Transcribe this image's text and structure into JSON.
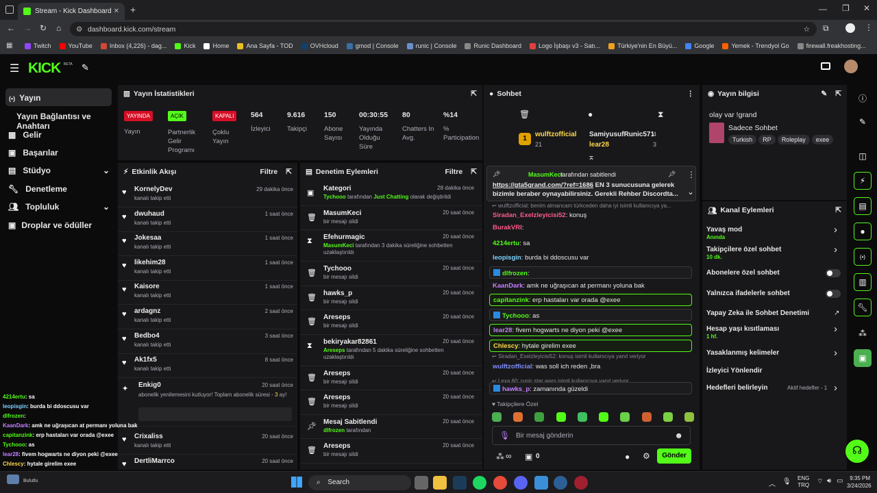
{
  "browser": {
    "tab_title": "Stream - Kick Dashboard",
    "url": "dashboard.kick.com/stream",
    "bookmarks": [
      "Twitch",
      "YouTube",
      "Inbox (4,226) - dag...",
      "Kick",
      "Home",
      "Ana Sayfa - TOD",
      "OVHcloud",
      "gmod | Console",
      "runic | Console",
      "Runic Dashboard",
      "Logo İşbaşı v3 - Satı...",
      "Türkiye'nin En Büyü...",
      "Google",
      "Yemek - Trendyol Go",
      "firewall.freakhosting..."
    ]
  },
  "logo": {
    "text": "KICK",
    "beta": "BETA"
  },
  "nav": {
    "items": [
      {
        "label": "Yayın",
        "icon": "broadcast-icon"
      },
      {
        "label": "Yayın Bağlantısı ve Anahtarı"
      },
      {
        "label": "Gelir",
        "icon": "money-icon"
      },
      {
        "label": "Başarılar",
        "icon": "trophy-icon"
      },
      {
        "label": "Stüdyo",
        "icon": "studio-icon"
      },
      {
        "label": "Denetleme",
        "icon": "wrench-icon"
      },
      {
        "label": "Topluluk",
        "icon": "people-icon"
      },
      {
        "label": "Droplar ve ödüller",
        "icon": "gift-icon"
      }
    ]
  },
  "stats": {
    "title": "Yayın İstatistikleri",
    "items": [
      {
        "badge": "YAYINDA",
        "label": "Yayın"
      },
      {
        "badge": "AÇIK",
        "label": "Partnerlik Gelir Programı"
      },
      {
        "badge": "KAPALI",
        "label": "Çoklu Yayın"
      },
      {
        "value": "564",
        "label": "İzleyici"
      },
      {
        "value": "9.616",
        "label": "Takipçi"
      },
      {
        "value": "150",
        "label": "Abone Sayısı"
      },
      {
        "value": "00:30:55",
        "label": "Yayında Olduğu Süre"
      },
      {
        "value": "80",
        "label": "Chatters In Avg."
      },
      {
        "value": "%14",
        "label": "% Participation"
      }
    ]
  },
  "activity": {
    "title": "Etkinlik Akışı",
    "filter": "Filtre",
    "items": [
      {
        "name": "KornelyDev",
        "sub": "kanalı takip etti",
        "time": "29 dakika önce"
      },
      {
        "name": "dwuhaud",
        "sub": "kanalı takip etti",
        "time": "1 saat önce"
      },
      {
        "name": "Jokesaa",
        "sub": "kanalı takip etti",
        "time": "1 saat önce"
      },
      {
        "name": "likehim28",
        "sub": "kanalı takip etti",
        "time": "1 saat önce"
      },
      {
        "name": "Kaisore",
        "sub": "kanalı takip etti",
        "time": "1 saat önce"
      },
      {
        "name": "ardagnz",
        "sub": "kanalı takip etti",
        "time": "2 saat önce"
      },
      {
        "name": "Bedbo4",
        "sub": "kanalı takip etti",
        "time": "3 saat önce"
      },
      {
        "name": "Ak1fx5",
        "sub": "kanalı takip etti",
        "time": "8 saat önce"
      }
    ],
    "sub_item": {
      "name": "Enkig0",
      "text_a": "abonelik yenilemesini kutluyor! Toplam abonelik süresi - ",
      "text_b": "3",
      "text_c": " ay!",
      "time": "20 saat önce"
    },
    "after": [
      {
        "name": "Crixaliss",
        "sub": "kanalı takip etti",
        "time": "20 saat önce"
      },
      {
        "name": "DertliMarrco",
        "sub": "",
        "time": "20 saat önce"
      }
    ]
  },
  "moderation": {
    "title": "Denetim Eylemleri",
    "filter": "Filtre",
    "items": [
      {
        "name": "Kategori",
        "actor": "Tychooo",
        "mid": " tarafından ",
        "target": "Just Chatting",
        "rest": " olarak değiştirildi",
        "time": "28 dakika önce",
        "icon": "category-icon"
      },
      {
        "name": "MasumKeci",
        "sub": "bir mesajı sildi",
        "time": "20 saat önce",
        "icon": "trash-icon"
      },
      {
        "name": "Efehurmagic",
        "actor": "MasumKeci",
        "rest": " tarafından 3 dakika süreliğine sohbetten uzaklaştırıldı",
        "time": "20 saat önce",
        "icon": "hourglass-icon"
      },
      {
        "name": "Tychooo",
        "sub": "bir mesajı sildi",
        "time": "20 saat önce",
        "icon": "trash-icon"
      },
      {
        "name": "hawks_p",
        "sub": "bir mesajı sildi",
        "time": "20 saat önce",
        "icon": "trash-icon"
      },
      {
        "name": "Areseps",
        "sub": "bir mesajı sildi",
        "time": "20 saat önce",
        "icon": "trash-icon"
      },
      {
        "name": "bekiryakar82861",
        "actor": "Areseps",
        "rest": " tarafından 5 dakika süreliğine sohbetten uzaklaştırıldı",
        "time": "20 saat önce",
        "icon": "hourglass-icon"
      },
      {
        "name": "Areseps",
        "sub": "bir mesajı sildi",
        "time": "20 saat önce",
        "icon": "trash-icon"
      },
      {
        "name": "Areseps",
        "sub": "bir mesajı sildi",
        "time": "20 saat önce",
        "icon": "trash-icon"
      },
      {
        "name": "Mesaj Sabitlendi",
        "actor": "dlfrozen",
        "rest": " tarafından",
        "time": "20 saat önce",
        "icon": "pin-icon"
      },
      {
        "name": "Areseps",
        "sub": "bir mesajı sildi",
        "time": "20 saat önce",
        "icon": "trash-icon"
      }
    ]
  },
  "chat": {
    "title": "Sohbet",
    "top_gifter": {
      "rank": "1",
      "name": "wulftzofficial",
      "count": "21"
    },
    "gifters": [
      {
        "name": "SamiyusufRunic571",
        "count": "4"
      },
      {
        "name": "lear28",
        "count": "3"
      }
    ],
    "pinned": {
      "by": "MasumKeci",
      "by_suffix": " tarafından sabitlendi",
      "link": "https://gta5grand.com/?ref=1686",
      "text": " EN 3 sunucusuna gelerek bizimle beraber oynayabilirsiniz. Gerekli Rehber Discordta..."
    },
    "messages": [
      {
        "reply": "wulftzofficial: benim almancam türkceden daha iyi isimli kullanıcıya ya..."
      },
      {
        "user": "Siradan_Exelzleyicisi52",
        "text": "konuş",
        "color": "#ff5a8a"
      },
      {
        "user": "BurakVRI",
        "text": "",
        "color": "#ff5a8a"
      },
      {
        "user": "4214ertu",
        "text": "sa",
        "color": "#53fc18"
      },
      {
        "user": "leopisgin",
        "text": "burda bi ddoscusu var",
        "color": "#7fd3ff"
      },
      {
        "user": "dlfrozen",
        "text": "",
        "color": "#53fc18"
      },
      {
        "user": "KaanDark",
        "text": "amk ne uğraşıcan at permanı yoluna bak",
        "color": "#c580ff"
      },
      {
        "user": "capitanzink",
        "text": "erp hastaları var orada @exee",
        "color": "#53fc18"
      },
      {
        "user": "Tychooo",
        "text": "as",
        "color": "#53fc18"
      },
      {
        "user": "lear28",
        "text": "fivem hogwarts ne diyon peki @exee",
        "color": "#c580ff"
      },
      {
        "user": "Chlescy",
        "text": "hytale girelim exee",
        "color": "#ffd84a"
      },
      {
        "reply": "Siradan_Exelzleyicisi52: konuş isimli kullanıcıya yanıt veriyor"
      },
      {
        "user": "wulftzofficial",
        "text": "was soll ich reden ,bra",
        "color": "#7f8cff"
      },
      {
        "reply": "Lexa.60: runic star wars isimli kullanıcıya yanıt veriyor"
      },
      {
        "user": "hawks_p",
        "text": "zamanında güzeldi",
        "color": "#c580ff"
      }
    ],
    "emote_label": "Takipçilere Özel",
    "input_placeholder": "Bir mesaj gönderin",
    "points": "0",
    "send": "Gönder"
  },
  "info": {
    "title": "Yayın bilgisi",
    "stream_title": "olay var !grand",
    "category": "Sadece Sohbet",
    "tags": [
      "Turkish",
      "RP",
      "Roleplay",
      "exee"
    ]
  },
  "channel": {
    "title": "Kanal Eylemleri",
    "items": [
      {
        "label": "Yavaş mod",
        "sub": "Anında"
      },
      {
        "label": "Takipçilere özel sohbet",
        "sub": "10 dk."
      },
      {
        "label": "Abonelere özel sohbet"
      },
      {
        "label": "Yalnızca ifadelerle sohbet"
      },
      {
        "label": "Yapay Zeka ile Sohbet Denetimi"
      },
      {
        "label": "Hesap yaşı kısıtlaması",
        "sub": "1 hf."
      },
      {
        "label": "Yasaklanmış kelimeler"
      },
      {
        "label": "İzleyici Yönlendir"
      },
      {
        "label": "Hedefleri belirleyin",
        "extra": "Aktif hedefler - 1"
      }
    ]
  },
  "overlay": [
    {
      "user": "4214ertu",
      "text": ": sa",
      "color": "#53fc18"
    },
    {
      "user": "leopisgin",
      "text": ": burda bi ddoscusu var",
      "color": "#7fd3ff"
    },
    {
      "user": "dlfrozen",
      "text": ":",
      "color": "#53fc18"
    },
    {
      "user": "KaanDark",
      "text": ": amk ne uğraşıcan at permanı yoluna bak",
      "color": "#c580ff"
    },
    {
      "user": "capitanzink",
      "text": ": erp hastaları var orada @exee",
      "color": "#53fc18"
    },
    {
      "user": "Tychooo",
      "text": ": as",
      "color": "#53fc18"
    },
    {
      "user": "lear28",
      "text": ": fivem hogwarts ne diyon peki @exee",
      "color": "#c580ff"
    },
    {
      "user": "Chlescy",
      "text": ": hytale girelim exee",
      "color": "#ffd84a"
    },
    {
      "user": "wulftzofficial",
      "text": ": was soll ich reden ,bra",
      "color": "#7f8cff"
    },
    {
      "user": "hawks_p",
      "text": ": zamanında güzeldi",
      "color": "#c580ff"
    }
  ],
  "taskbar": {
    "search": "Search",
    "lang": "ENG",
    "lang2": "TRQ",
    "time": "9:35 PM",
    "date": "3/24/2026",
    "weather": "Bulutlu"
  }
}
